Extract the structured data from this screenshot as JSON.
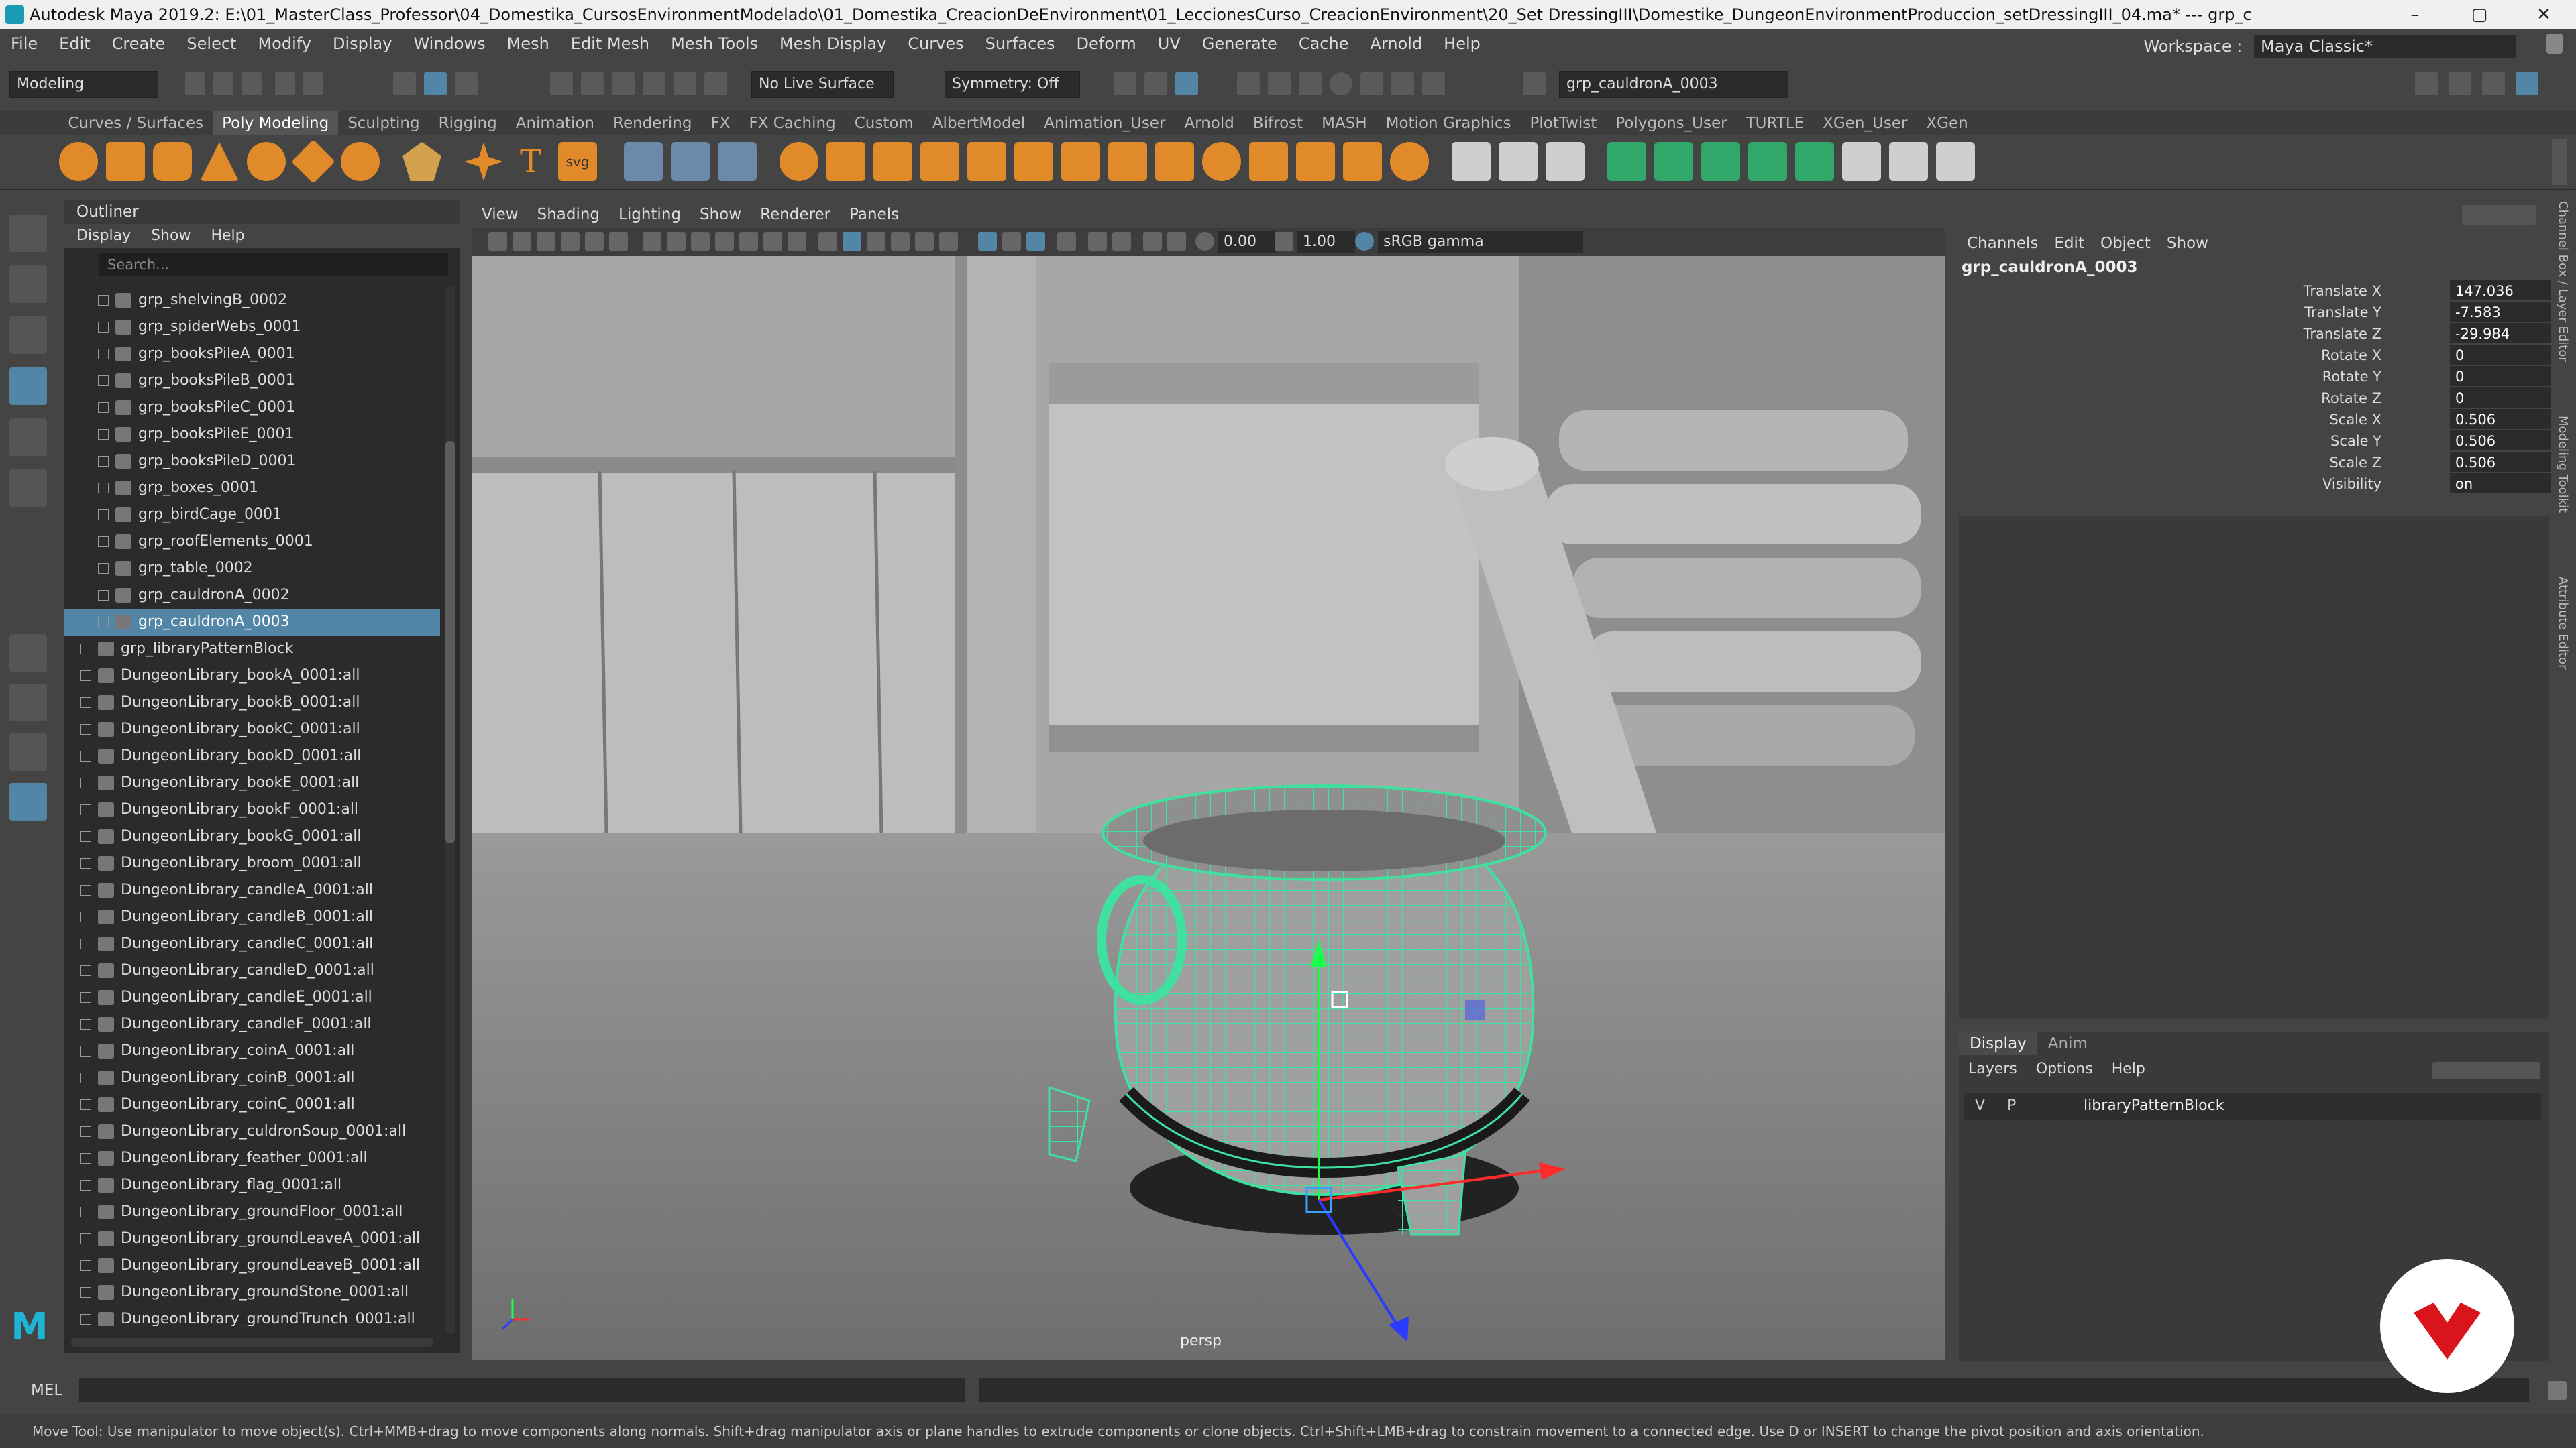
{
  "window": {
    "title": "Autodesk Maya 2019.2: E:\\01_MasterClass_Professor\\04_Domestika_CursosEnvironmentModelado\\01_Domestika_CreacionDeEnvironment\\01_LeccionesCurso_CreacionEnvironment\\20_Set DressingIII\\Domestike_DungeonEnvironmentProduccion_setDressingIII_04.ma*  ---  grp_c",
    "minimize": "–",
    "maximize": "▢",
    "close": "✕"
  },
  "menubar": {
    "items": [
      "File",
      "Edit",
      "Create",
      "Select",
      "Modify",
      "Display",
      "Windows",
      "Mesh",
      "Edit Mesh",
      "Mesh Tools",
      "Mesh Display",
      "Curves",
      "Surfaces",
      "Deform",
      "UV",
      "Generate",
      "Cache",
      "Arnold",
      "Help"
    ],
    "workspace_label": "Workspace :",
    "workspace_value": "Maya Classic*"
  },
  "statusline": {
    "mode": "Modeling",
    "live_surface": "No Live Surface",
    "symmetry": "Symmetry: Off",
    "name_field": "grp_cauldronA_0003"
  },
  "shelf": {
    "tabs": [
      "Curves / Surfaces",
      "Poly Modeling",
      "Sculpting",
      "Rigging",
      "Animation",
      "Rendering",
      "FX",
      "FX Caching",
      "Custom",
      "AlbertModel",
      "Animation_User",
      "Arnold",
      "Bifrost",
      "MASH",
      "Motion Graphics",
      "PlotTwist",
      "Polygons_User",
      "TURTLE",
      "XGen_User",
      "XGen"
    ],
    "active_tab": "Poly Modeling",
    "text_icon": "T",
    "svg_icon": "svg"
  },
  "outliner": {
    "title": "Outliner",
    "menu": [
      "Display",
      "Show",
      "Help"
    ],
    "search_placeholder": "Search...",
    "items": [
      {
        "label": "grp_shelvingB_0002",
        "indent": 1
      },
      {
        "label": "grp_spiderWebs_0001",
        "indent": 1
      },
      {
        "label": "grp_booksPileA_0001",
        "indent": 1
      },
      {
        "label": "grp_booksPileB_0001",
        "indent": 1
      },
      {
        "label": "grp_booksPileC_0001",
        "indent": 1
      },
      {
        "label": "grp_booksPileE_0001",
        "indent": 1
      },
      {
        "label": "grp_booksPileD_0001",
        "indent": 1
      },
      {
        "label": "grp_boxes_0001",
        "indent": 1
      },
      {
        "label": "grp_birdCage_0001",
        "indent": 1
      },
      {
        "label": "grp_roofElements_0001",
        "indent": 1
      },
      {
        "label": "grp_table_0002",
        "indent": 1
      },
      {
        "label": "grp_cauldronA_0002",
        "indent": 1
      },
      {
        "label": "grp_cauldronA_0003",
        "indent": 1,
        "selected": true
      },
      {
        "label": "grp_libraryPatternBlock",
        "indent": 0
      },
      {
        "label": "DungeonLibrary_bookA_0001:all",
        "indent": 0
      },
      {
        "label": "DungeonLibrary_bookB_0001:all",
        "indent": 0
      },
      {
        "label": "DungeonLibrary_bookC_0001:all",
        "indent": 0
      },
      {
        "label": "DungeonLibrary_bookD_0001:all",
        "indent": 0
      },
      {
        "label": "DungeonLibrary_bookE_0001:all",
        "indent": 0
      },
      {
        "label": "DungeonLibrary_bookF_0001:all",
        "indent": 0
      },
      {
        "label": "DungeonLibrary_bookG_0001:all",
        "indent": 0
      },
      {
        "label": "DungeonLibrary_broom_0001:all",
        "indent": 0
      },
      {
        "label": "DungeonLibrary_candleA_0001:all",
        "indent": 0
      },
      {
        "label": "DungeonLibrary_candleB_0001:all",
        "indent": 0
      },
      {
        "label": "DungeonLibrary_candleC_0001:all",
        "indent": 0
      },
      {
        "label": "DungeonLibrary_candleD_0001:all",
        "indent": 0
      },
      {
        "label": "DungeonLibrary_candleE_0001:all",
        "indent": 0
      },
      {
        "label": "DungeonLibrary_candleF_0001:all",
        "indent": 0
      },
      {
        "label": "DungeonLibrary_coinA_0001:all",
        "indent": 0
      },
      {
        "label": "DungeonLibrary_coinB_0001:all",
        "indent": 0
      },
      {
        "label": "DungeonLibrary_coinC_0001:all",
        "indent": 0
      },
      {
        "label": "DungeonLibrary_culdronSoup_0001:all",
        "indent": 0
      },
      {
        "label": "DungeonLibrary_feather_0001:all",
        "indent": 0
      },
      {
        "label": "DungeonLibrary_flag_0001:all",
        "indent": 0
      },
      {
        "label": "DungeonLibrary_groundFloor_0001:all",
        "indent": 0
      },
      {
        "label": "DungeonLibrary_groundLeaveA_0001:all",
        "indent": 0
      },
      {
        "label": "DungeonLibrary_groundLeaveB_0001:all",
        "indent": 0
      },
      {
        "label": "DungeonLibrary_groundStone_0001:all",
        "indent": 0
      },
      {
        "label": "DungeonLibrary_groundTrunch_0001:all",
        "indent": 0
      }
    ]
  },
  "viewport": {
    "menu": [
      "View",
      "Shading",
      "Lighting",
      "Show",
      "Renderer",
      "Panels"
    ],
    "exposure": "0.00",
    "gamma": "1.00",
    "colorspace": "sRGB gamma",
    "camera_label": "persp",
    "wire_color": "#3fe0a0"
  },
  "channelbox": {
    "menu": [
      "Channels",
      "Edit",
      "Object",
      "Show"
    ],
    "object_name": "grp_cauldronA_0003",
    "attributes": [
      {
        "name": "Translate X",
        "value": "147.036"
      },
      {
        "name": "Translate Y",
        "value": "-7.583"
      },
      {
        "name": "Translate Z",
        "value": "-29.984"
      },
      {
        "name": "Rotate X",
        "value": "0"
      },
      {
        "name": "Rotate Y",
        "value": "0"
      },
      {
        "name": "Rotate Z",
        "value": "0"
      },
      {
        "name": "Scale X",
        "value": "0.506"
      },
      {
        "name": "Scale Y",
        "value": "0.506"
      },
      {
        "name": "Scale Z",
        "value": "0.506"
      },
      {
        "name": "Visibility",
        "value": "on"
      }
    ],
    "side_tabs": [
      "Channel Box / Layer Editor",
      "Modeling Toolkit",
      "Attribute Editor"
    ]
  },
  "layers": {
    "tabs": [
      "Display",
      "Anim"
    ],
    "active_tab": "Display",
    "menu": [
      "Layers",
      "Options",
      "Help"
    ],
    "rows": [
      {
        "v": "V",
        "p": "P",
        "name": "libraryPatternBlock"
      }
    ]
  },
  "cmdline": {
    "label": "MEL"
  },
  "helpline": {
    "text": "Move Tool: Use manipulator to move object(s). Ctrl+MMB+drag to move components along normals. Shift+drag manipulator axis or plane handles to extrude components or clone objects. Ctrl+Shift+LMB+drag to constrain movement to a connected edge. Use D or INSERT to change the pivot position and axis orientation."
  },
  "branding": {
    "maya_logo": "M",
    "badge_color": "#d9141b"
  }
}
